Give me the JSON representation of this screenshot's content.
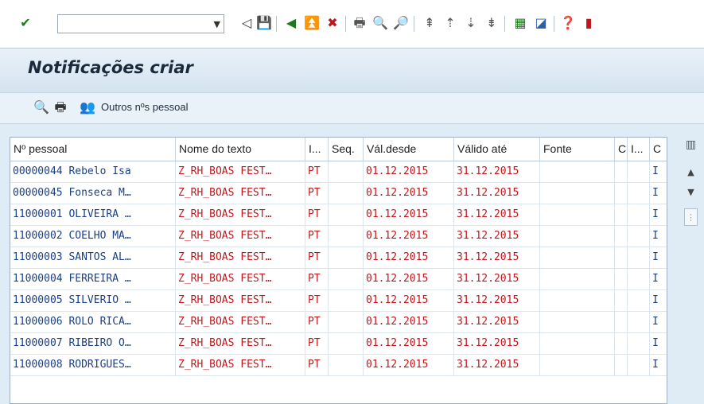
{
  "toolbar": {
    "command_field_value": "",
    "icons": [
      "ok-checkmark-icon",
      "back-triangle-icon",
      "save-icon",
      "back-icon",
      "exit-icon",
      "cancel-icon",
      "print-icon",
      "find-icon",
      "find-next-icon",
      "first-page-icon",
      "previous-page-icon",
      "next-page-icon",
      "last-page-icon",
      "create-session-icon",
      "shortcut-icon",
      "help-icon",
      "customize-icon"
    ]
  },
  "title": "Notificações criar",
  "app_toolbar": {
    "other_personnel_label": "Outros nºs pessoal"
  },
  "table": {
    "columns": [
      "Nº pessoal",
      "Nome do texto",
      "I...",
      "Seq.",
      "Vál.desde",
      "Válido até",
      "Fonte",
      "C",
      "I...",
      "C"
    ],
    "rows": [
      {
        "pernr": "00000044 Rebelo Isa",
        "text": "Z_RH_BOAS FEST…",
        "lang": "PT",
        "seq": "",
        "from": "01.12.2015",
        "to": "31.12.2015",
        "fonte": "",
        "c1": "",
        "i2": "",
        "c2": "I"
      },
      {
        "pernr": "00000045 Fonseca M…",
        "text": "Z_RH_BOAS FEST…",
        "lang": "PT",
        "seq": "",
        "from": "01.12.2015",
        "to": "31.12.2015",
        "fonte": "",
        "c1": "",
        "i2": "",
        "c2": "I"
      },
      {
        "pernr": "11000001 OLIVEIRA …",
        "text": "Z_RH_BOAS FEST…",
        "lang": "PT",
        "seq": "",
        "from": "01.12.2015",
        "to": "31.12.2015",
        "fonte": "",
        "c1": "",
        "i2": "",
        "c2": "I"
      },
      {
        "pernr": "11000002 COELHO MA…",
        "text": "Z_RH_BOAS FEST…",
        "lang": "PT",
        "seq": "",
        "from": "01.12.2015",
        "to": "31.12.2015",
        "fonte": "",
        "c1": "",
        "i2": "",
        "c2": "I"
      },
      {
        "pernr": "11000003 SANTOS AL…",
        "text": "Z_RH_BOAS FEST…",
        "lang": "PT",
        "seq": "",
        "from": "01.12.2015",
        "to": "31.12.2015",
        "fonte": "",
        "c1": "",
        "i2": "",
        "c2": "I"
      },
      {
        "pernr": "11000004 FERREIRA …",
        "text": "Z_RH_BOAS FEST…",
        "lang": "PT",
        "seq": "",
        "from": "01.12.2015",
        "to": "31.12.2015",
        "fonte": "",
        "c1": "",
        "i2": "",
        "c2": "I"
      },
      {
        "pernr": "11000005 SILVERIO …",
        "text": "Z_RH_BOAS FEST…",
        "lang": "PT",
        "seq": "",
        "from": "01.12.2015",
        "to": "31.12.2015",
        "fonte": "",
        "c1": "",
        "i2": "",
        "c2": "I"
      },
      {
        "pernr": "11000006 ROLO RICA…",
        "text": "Z_RH_BOAS FEST…",
        "lang": "PT",
        "seq": "",
        "from": "01.12.2015",
        "to": "31.12.2015",
        "fonte": "",
        "c1": "",
        "i2": "",
        "c2": "I"
      },
      {
        "pernr": "11000007 RIBEIRO O…",
        "text": "Z_RH_BOAS FEST…",
        "lang": "PT",
        "seq": "",
        "from": "01.12.2015",
        "to": "31.12.2015",
        "fonte": "",
        "c1": "",
        "i2": "",
        "c2": "I"
      },
      {
        "pernr": "11000008 RODRIGUES…",
        "text": "Z_RH_BOAS FEST…",
        "lang": "PT",
        "seq": "",
        "from": "01.12.2015",
        "to": "31.12.2015",
        "fonte": "",
        "c1": "",
        "i2": "",
        "c2": "I"
      }
    ]
  },
  "colors": {
    "link_blue": "#1a3f86",
    "text_red": "#c0171c",
    "window_bg": "#dfebf5"
  }
}
